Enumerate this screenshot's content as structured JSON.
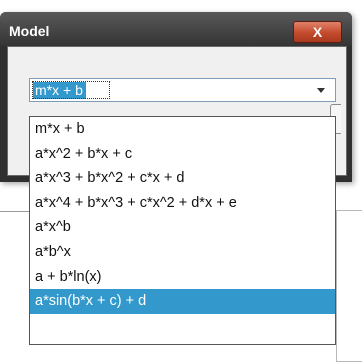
{
  "dialog": {
    "title": "Model",
    "close_label": "X"
  },
  "combo": {
    "selected_value": "m*x + b"
  },
  "dropdown": {
    "items": [
      {
        "label": "m*x + b",
        "selected": false
      },
      {
        "label": "a*x^2 + b*x + c",
        "selected": false
      },
      {
        "label": "a*x^3 + b*x^2 + c*x + d",
        "selected": false
      },
      {
        "label": "a*x^4 + b*x^3 + c*x^2 + d*x + e",
        "selected": false
      },
      {
        "label": "a*x^b",
        "selected": false
      },
      {
        "label": "a*b^x",
        "selected": false
      },
      {
        "label": "a + b*ln(x)",
        "selected": false
      },
      {
        "label": "a*sin(b*x + c) + d",
        "selected": true
      }
    ]
  },
  "colors": {
    "highlight": "#3399cc",
    "close_button": "#c44a2c",
    "titlebar": "#3a3a3a"
  },
  "icons": {
    "close": "close-icon",
    "dropdown_arrow": "chevron-down-icon"
  }
}
